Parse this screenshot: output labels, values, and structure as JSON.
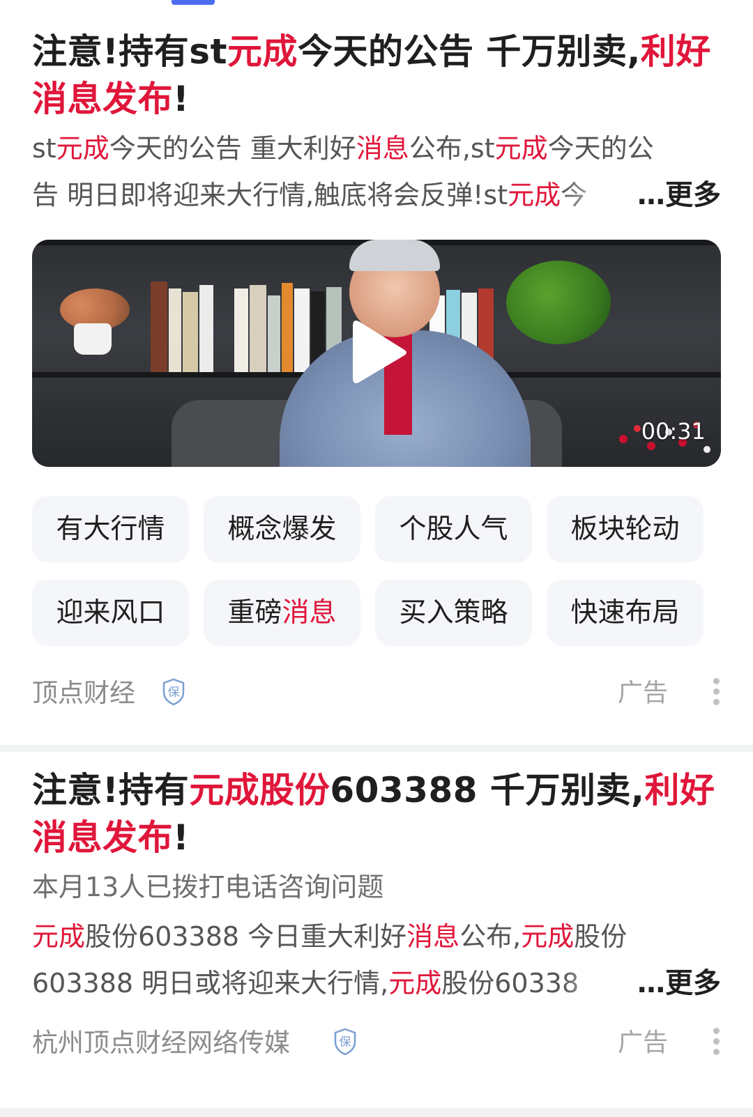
{
  "colors": {
    "accent": "#e0163a",
    "tab_indicator": "#4e6ef2",
    "tag_bg": "#f5f6f9"
  },
  "ad1": {
    "title": [
      {
        "t": "注意!持有st",
        "hl": false
      },
      {
        "t": "元成",
        "hl": true
      },
      {
        "t": "今天的公告 千万别卖,",
        "hl": false
      },
      {
        "t": "利好消息发布",
        "hl": true
      },
      {
        "t": "!",
        "hl": false
      }
    ],
    "desc_line1": [
      {
        "t": "st",
        "hl": false
      },
      {
        "t": "元成",
        "hl": true
      },
      {
        "t": "今天的公告 重大利好",
        "hl": false
      },
      {
        "t": "消息",
        "hl": true
      },
      {
        "t": "公布,st",
        "hl": false
      },
      {
        "t": "元成",
        "hl": true
      },
      {
        "t": "今天的公",
        "hl": false
      }
    ],
    "desc_line2": [
      {
        "t": "告 明日即将迎来大行情,触底将会反弹!st",
        "hl": false
      },
      {
        "t": "元成",
        "hl": true
      },
      {
        "t": "今",
        "hl": false
      }
    ],
    "more_label": "…更多",
    "video_duration": "00:31",
    "tags": [
      "有大行情",
      "概念爆发",
      "个股人气",
      "板块轮动",
      "迎来风口",
      "重磅消息",
      "买入策略",
      "快速布局"
    ],
    "tag_highlights": {
      "重磅消息": "消息"
    },
    "source": "顶点财经",
    "ad_label": "广告",
    "icons": [
      "play-icon",
      "bao-shield-icon",
      "more-vertical-icon"
    ]
  },
  "ad2": {
    "title": [
      {
        "t": "注意!持有",
        "hl": false
      },
      {
        "t": "元成股份",
        "hl": true
      },
      {
        "t": "603388 千万别卖,",
        "hl": false
      },
      {
        "t": "利好消息发布",
        "hl": true
      },
      {
        "t": "!",
        "hl": false
      }
    ],
    "subtitle": "本月13人已拨打电话咨询问题",
    "desc_line1": [
      {
        "t": "元成",
        "hl": true
      },
      {
        "t": "股份603388 今日重大利好",
        "hl": false
      },
      {
        "t": "消息",
        "hl": true
      },
      {
        "t": "公布,",
        "hl": false
      },
      {
        "t": "元成",
        "hl": true
      },
      {
        "t": "股份",
        "hl": false
      }
    ],
    "desc_line2": [
      {
        "t": "603388 明日或将迎来大行情,",
        "hl": false
      },
      {
        "t": "元成",
        "hl": true
      },
      {
        "t": "股份60338",
        "hl": false
      }
    ],
    "more_label": "…更多",
    "source": "杭州顶点财经网络传媒",
    "ad_label": "广告"
  }
}
